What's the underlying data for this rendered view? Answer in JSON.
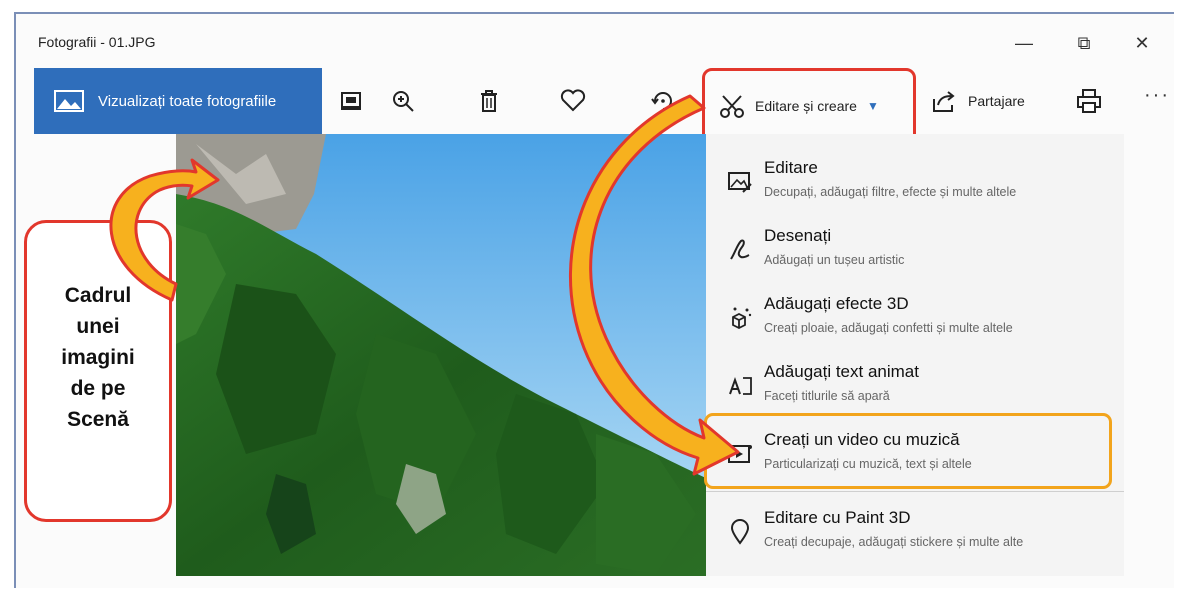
{
  "window": {
    "title": "Fotografii - 01.JPG",
    "minimize": "—",
    "maximize": "⧉",
    "close": "✕"
  },
  "toolbar": {
    "view_all_label": "Vizualizați toate fotografiile",
    "icons": [
      "slideshow-icon",
      "zoom-in-icon",
      "delete-icon",
      "heart-icon",
      "rotate-icon"
    ],
    "edit_create_label": "Editare și creare",
    "share_label": "Partajare",
    "more_label": "···"
  },
  "menu": {
    "items": [
      {
        "title": "Editare",
        "subtitle": "Decupați, adăugați filtre, efecte și multe altele",
        "icon": "edit-photo-icon"
      },
      {
        "title": "Desenați",
        "subtitle": "Adăugați un tușeu artistic",
        "icon": "draw-icon"
      },
      {
        "title": "Adăugați efecte 3D",
        "subtitle": "Creați ploaie, adăugați confetti și multe altele",
        "icon": "effects-3d-icon"
      },
      {
        "title": "Adăugați text animat",
        "subtitle": "Faceți titlurile să apară",
        "icon": "animated-text-icon"
      },
      {
        "title": "Creați un video cu muzică",
        "subtitle": "Particularizați cu muzică, text și altele",
        "icon": "video-music-icon"
      },
      {
        "title": "Editare cu Paint 3D",
        "subtitle": "Creați decupaje, adăugați stickere și multe alte",
        "icon": "paint3d-icon"
      }
    ]
  },
  "callout": {
    "lines": [
      "Cadrul",
      "unei",
      "imagini",
      "de pe",
      "Scenă"
    ]
  },
  "colors": {
    "accent": "#2f6ebb",
    "annotation_red": "#e2372c",
    "annotation_orange": "#f2a41c"
  }
}
